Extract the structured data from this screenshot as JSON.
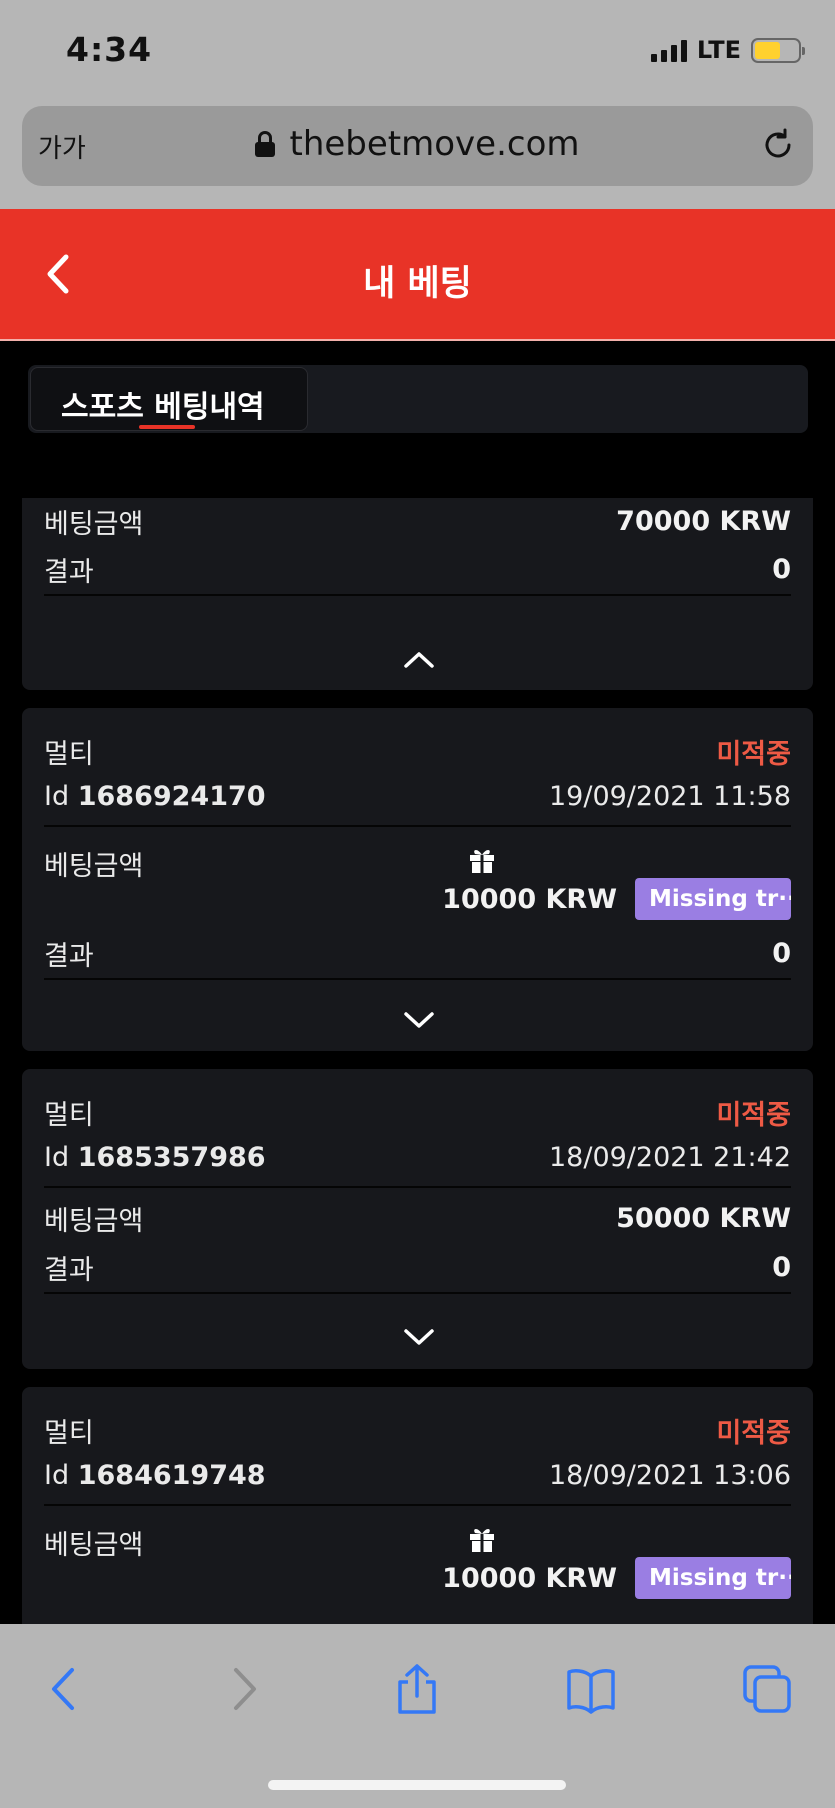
{
  "status_bar": {
    "time": "4:34",
    "network": "LTE"
  },
  "browser": {
    "text_size_label": "가가",
    "url": "thebetmove.com"
  },
  "header": {
    "title": "내 베팅"
  },
  "tabs": [
    {
      "label": "스포츠 베팅내역"
    }
  ],
  "partial_card": {
    "stake_label": "베팅금액",
    "stake": "70000 KRW",
    "result_label": "결과",
    "result": "0"
  },
  "cards": [
    {
      "type": "멀티",
      "status": "미적중",
      "id_prefix": "Id",
      "id": "1686924170",
      "datetime": "19/09/2021 11:58",
      "stake_label": "베팅금액",
      "stake": "10000 KRW",
      "badge": "Missing tr···",
      "result_label": "결과",
      "result": "0"
    },
    {
      "type": "멀티",
      "status": "미적중",
      "id_prefix": "Id",
      "id": "1685357986",
      "datetime": "18/09/2021 21:42",
      "stake_label": "베팅금액",
      "stake": "50000 KRW",
      "result_label": "결과",
      "result": "0"
    },
    {
      "type": "멀티",
      "status": "미적중",
      "id_prefix": "Id",
      "id": "1684619748",
      "datetime": "18/09/2021 13:06",
      "stake_label": "베팅금액",
      "stake": "10000 KRW",
      "badge": "Missing tr···"
    }
  ],
  "colors": {
    "header": "#e83327",
    "card": "#17181c",
    "status_lost": "#ee5a45",
    "badge": "#9a7ee3",
    "ios_blue": "#3478f6"
  }
}
